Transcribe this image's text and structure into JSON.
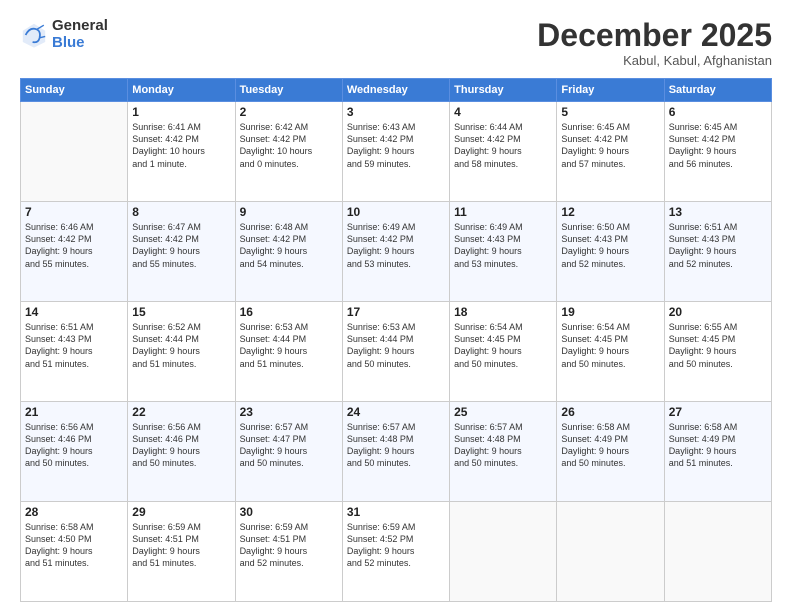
{
  "logo": {
    "general": "General",
    "blue": "Blue"
  },
  "header": {
    "month": "December 2025",
    "location": "Kabul, Kabul, Afghanistan"
  },
  "weekdays": [
    "Sunday",
    "Monday",
    "Tuesday",
    "Wednesday",
    "Thursday",
    "Friday",
    "Saturday"
  ],
  "weeks": [
    [
      {
        "day": "",
        "info": ""
      },
      {
        "day": "1",
        "info": "Sunrise: 6:41 AM\nSunset: 4:42 PM\nDaylight: 10 hours\nand 1 minute."
      },
      {
        "day": "2",
        "info": "Sunrise: 6:42 AM\nSunset: 4:42 PM\nDaylight: 10 hours\nand 0 minutes."
      },
      {
        "day": "3",
        "info": "Sunrise: 6:43 AM\nSunset: 4:42 PM\nDaylight: 9 hours\nand 59 minutes."
      },
      {
        "day": "4",
        "info": "Sunrise: 6:44 AM\nSunset: 4:42 PM\nDaylight: 9 hours\nand 58 minutes."
      },
      {
        "day": "5",
        "info": "Sunrise: 6:45 AM\nSunset: 4:42 PM\nDaylight: 9 hours\nand 57 minutes."
      },
      {
        "day": "6",
        "info": "Sunrise: 6:45 AM\nSunset: 4:42 PM\nDaylight: 9 hours\nand 56 minutes."
      }
    ],
    [
      {
        "day": "7",
        "info": "Sunrise: 6:46 AM\nSunset: 4:42 PM\nDaylight: 9 hours\nand 55 minutes."
      },
      {
        "day": "8",
        "info": "Sunrise: 6:47 AM\nSunset: 4:42 PM\nDaylight: 9 hours\nand 55 minutes."
      },
      {
        "day": "9",
        "info": "Sunrise: 6:48 AM\nSunset: 4:42 PM\nDaylight: 9 hours\nand 54 minutes."
      },
      {
        "day": "10",
        "info": "Sunrise: 6:49 AM\nSunset: 4:42 PM\nDaylight: 9 hours\nand 53 minutes."
      },
      {
        "day": "11",
        "info": "Sunrise: 6:49 AM\nSunset: 4:43 PM\nDaylight: 9 hours\nand 53 minutes."
      },
      {
        "day": "12",
        "info": "Sunrise: 6:50 AM\nSunset: 4:43 PM\nDaylight: 9 hours\nand 52 minutes."
      },
      {
        "day": "13",
        "info": "Sunrise: 6:51 AM\nSunset: 4:43 PM\nDaylight: 9 hours\nand 52 minutes."
      }
    ],
    [
      {
        "day": "14",
        "info": "Sunrise: 6:51 AM\nSunset: 4:43 PM\nDaylight: 9 hours\nand 51 minutes."
      },
      {
        "day": "15",
        "info": "Sunrise: 6:52 AM\nSunset: 4:44 PM\nDaylight: 9 hours\nand 51 minutes."
      },
      {
        "day": "16",
        "info": "Sunrise: 6:53 AM\nSunset: 4:44 PM\nDaylight: 9 hours\nand 51 minutes."
      },
      {
        "day": "17",
        "info": "Sunrise: 6:53 AM\nSunset: 4:44 PM\nDaylight: 9 hours\nand 50 minutes."
      },
      {
        "day": "18",
        "info": "Sunrise: 6:54 AM\nSunset: 4:45 PM\nDaylight: 9 hours\nand 50 minutes."
      },
      {
        "day": "19",
        "info": "Sunrise: 6:54 AM\nSunset: 4:45 PM\nDaylight: 9 hours\nand 50 minutes."
      },
      {
        "day": "20",
        "info": "Sunrise: 6:55 AM\nSunset: 4:45 PM\nDaylight: 9 hours\nand 50 minutes."
      }
    ],
    [
      {
        "day": "21",
        "info": "Sunrise: 6:56 AM\nSunset: 4:46 PM\nDaylight: 9 hours\nand 50 minutes."
      },
      {
        "day": "22",
        "info": "Sunrise: 6:56 AM\nSunset: 4:46 PM\nDaylight: 9 hours\nand 50 minutes."
      },
      {
        "day": "23",
        "info": "Sunrise: 6:57 AM\nSunset: 4:47 PM\nDaylight: 9 hours\nand 50 minutes."
      },
      {
        "day": "24",
        "info": "Sunrise: 6:57 AM\nSunset: 4:48 PM\nDaylight: 9 hours\nand 50 minutes."
      },
      {
        "day": "25",
        "info": "Sunrise: 6:57 AM\nSunset: 4:48 PM\nDaylight: 9 hours\nand 50 minutes."
      },
      {
        "day": "26",
        "info": "Sunrise: 6:58 AM\nSunset: 4:49 PM\nDaylight: 9 hours\nand 50 minutes."
      },
      {
        "day": "27",
        "info": "Sunrise: 6:58 AM\nSunset: 4:49 PM\nDaylight: 9 hours\nand 51 minutes."
      }
    ],
    [
      {
        "day": "28",
        "info": "Sunrise: 6:58 AM\nSunset: 4:50 PM\nDaylight: 9 hours\nand 51 minutes."
      },
      {
        "day": "29",
        "info": "Sunrise: 6:59 AM\nSunset: 4:51 PM\nDaylight: 9 hours\nand 51 minutes."
      },
      {
        "day": "30",
        "info": "Sunrise: 6:59 AM\nSunset: 4:51 PM\nDaylight: 9 hours\nand 52 minutes."
      },
      {
        "day": "31",
        "info": "Sunrise: 6:59 AM\nSunset: 4:52 PM\nDaylight: 9 hours\nand 52 minutes."
      },
      {
        "day": "",
        "info": ""
      },
      {
        "day": "",
        "info": ""
      },
      {
        "day": "",
        "info": ""
      }
    ]
  ]
}
